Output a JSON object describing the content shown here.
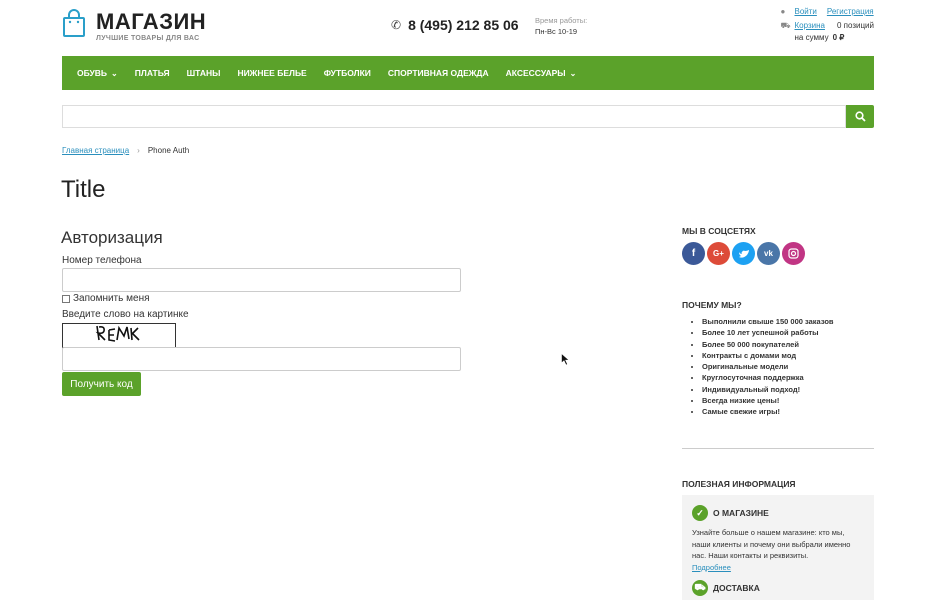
{
  "header": {
    "brand": "МАГАЗИН",
    "tagline": "ЛУЧШИЕ ТОВАРЫ ДЛЯ ВАС",
    "phone": "8 (495) 212 85 06",
    "hours_label": "Время работы:",
    "hours_value": "Пн-Вс 10-19",
    "login": "Войти",
    "register": "Регистрация",
    "cart": "Корзина",
    "cart_count": "0 позиций",
    "cart_sum_label": "на сумму",
    "cart_sum": "0 ₽"
  },
  "menu": [
    {
      "label": "ОБУВЬ",
      "dropdown": true
    },
    {
      "label": "ПЛАТЬЯ",
      "dropdown": false
    },
    {
      "label": "ШТАНЫ",
      "dropdown": false
    },
    {
      "label": "НИЖНЕЕ БЕЛЬЕ",
      "dropdown": false
    },
    {
      "label": "ФУТБОЛКИ",
      "dropdown": false
    },
    {
      "label": "СПОРТИВНАЯ ОДЕЖДА",
      "dropdown": false
    },
    {
      "label": "АКСЕССУАРЫ",
      "dropdown": true
    }
  ],
  "search": {
    "placeholder": ""
  },
  "breadcrumb": {
    "home": "Главная страница",
    "current": "Phone Auth"
  },
  "page_title": "Title",
  "form": {
    "title": "Авторизация",
    "phone_label": "Номер телефона",
    "phone_value": "",
    "remember_label": "Запомнить меня",
    "captcha_label": "Введите слово на картинке",
    "captcha_text": "REMK",
    "captcha_value": "",
    "submit": "Получить код"
  },
  "sidebar": {
    "social_title": "МЫ В СОЦСЕТЯХ",
    "socials": [
      "facebook-icon",
      "google-plus-icon",
      "twitter-icon",
      "vk-icon",
      "instagram-icon"
    ],
    "why_title": "ПОЧЕМУ МЫ?",
    "why_items": [
      "Выполнили свыше 150 000 заказов",
      "Более 10 лет успешной работы",
      "Более 50 000 покупателей",
      "Контракты с домами мод",
      "Оригинальные модели",
      "Круглосуточная поддержка",
      "Индивидуальный подход!",
      "Всегда низкие цены!",
      "Самые свежие игры!"
    ],
    "info_title": "ПОЛЕЗНАЯ ИНФОРМАЦИЯ",
    "about_title": "О МАГАЗИНЕ",
    "about_text": "Узнайте больше о нашем магазине: кто мы, наши клиенты и почему они выбрали именно нас. Наши контакты и реквизиты.",
    "about_link": "Подробнее",
    "delivery_title": "ДОСТАВКА"
  },
  "colors": {
    "accent": "#5ba22a",
    "link": "#2a8fbd"
  }
}
